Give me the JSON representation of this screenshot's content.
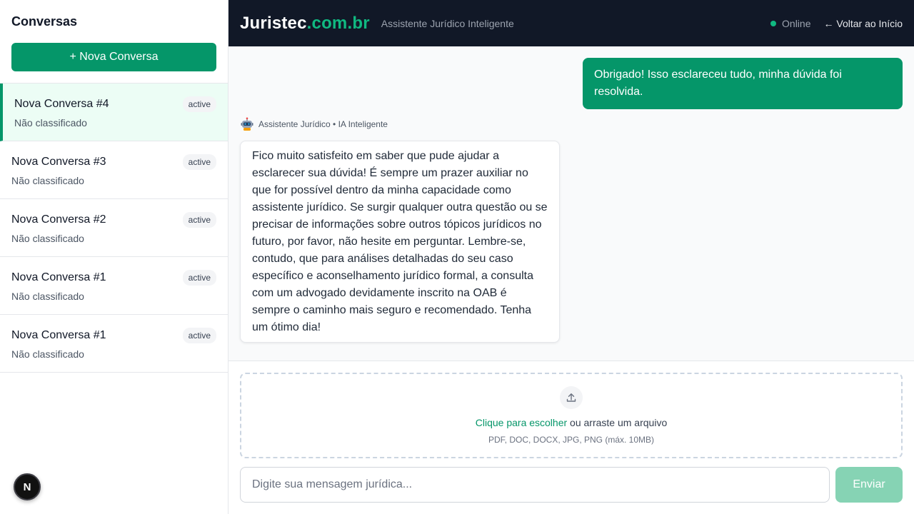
{
  "sidebar": {
    "title": "Conversas",
    "new_button": "+ Nova Conversa",
    "items": [
      {
        "title": "Nova Conversa #4",
        "subtitle": "Não classificado",
        "badge": "active",
        "selected": true
      },
      {
        "title": "Nova Conversa #3",
        "subtitle": "Não classificado",
        "badge": "active"
      },
      {
        "title": "Nova Conversa #2",
        "subtitle": "Não classificado",
        "badge": "active"
      },
      {
        "title": "Nova Conversa #1",
        "subtitle": "Não classificado",
        "badge": "active"
      },
      {
        "title": "Nova Conversa #1",
        "subtitle": "Não classificado",
        "badge": "active"
      }
    ]
  },
  "header": {
    "brand_main": "Juristec",
    "brand_accent": ".com.br",
    "tagline": "Assistente Jurídico Inteligente",
    "status": "Online",
    "back_link": "← Voltar ao Início"
  },
  "chat": {
    "messages": [
      {
        "role": "user",
        "text": "Obrigado! Isso esclareceu tudo, minha dúvida foi resolvida."
      },
      {
        "role": "assistant",
        "meta": "Assistente Jurídico • IA Inteligente",
        "text": "Fico muito satisfeito em saber que pude ajudar a esclarecer sua dúvida! É sempre um prazer auxiliar no que for possível dentro da minha capacidade como assistente jurídico. Se surgir qualquer outra questão ou se precisar de informações sobre outros tópicos jurídicos no futuro, por favor, não hesite em perguntar. Lembre-se, contudo, que para análises detalhadas do seu caso específico e aconselhamento jurídico formal, a consulta com um advogado devidamente inscrito na OAB é sempre o caminho mais seguro e recomendado. Tenha um ótimo dia!"
      }
    ]
  },
  "upload": {
    "link_text": "Clique para escolher",
    "rest_text": " ou arraste um arquivo",
    "hint": "PDF, DOC, DOCX, JPG, PNG (máx. 10MB)"
  },
  "composer": {
    "placeholder": "Digite sua mensagem jurídica...",
    "send_label": "Enviar"
  },
  "dev_badge": "N",
  "colors": {
    "accent": "#059669",
    "header_bg": "#111827",
    "send_disabled": "#86d3b4"
  }
}
